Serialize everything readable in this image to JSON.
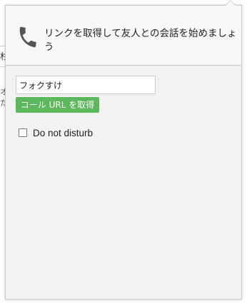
{
  "background": {
    "box_char": "杉",
    "text_line_1": "オ",
    "text_line_2": "た"
  },
  "popup": {
    "header_text": "リンクを取得して友人との会話を始めましょう",
    "icon": "phone-icon",
    "input": {
      "value": "フォクすけ",
      "placeholder": ""
    },
    "get_url_button_label": "コール URL を取得",
    "dnd": {
      "label": "Do not disturb",
      "checked": false
    }
  },
  "colors": {
    "button_green": "#5cb85c",
    "phone_icon": "#555555",
    "panel_bg": "#f2f2f2"
  }
}
